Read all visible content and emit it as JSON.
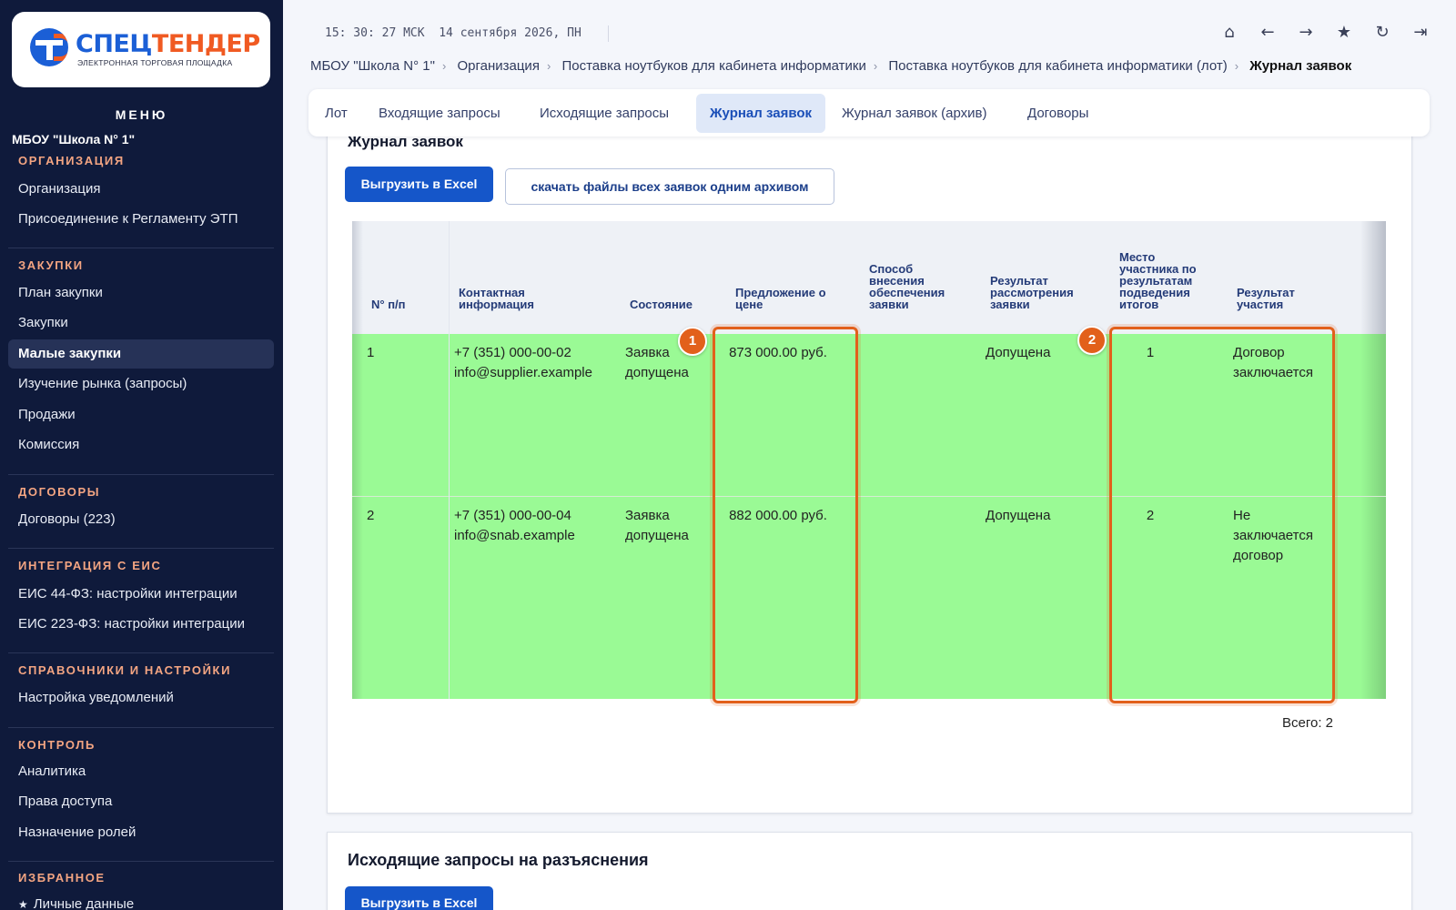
{
  "app": {
    "logo_main_a": "СПЕЦ",
    "logo_main_b": "ТЕНДЕР",
    "logo_sub": "ЭЛЕКТРОННАЯ ТОРГОВАЯ ПЛОЩАДКА",
    "colors": {
      "sidebar_bg": "#0f1a3b",
      "accent_blue": "#1556c9",
      "accent_orange": "#e2601b",
      "row_green": "#9afa95"
    }
  },
  "sidebar": {
    "menu_title": "МЕНЮ",
    "org_name": "МБОУ \"Школа N° 1\"",
    "sections": [
      {
        "title": "ОРГАНИЗАЦИЯ",
        "items": [
          "Организация",
          "Присоединение к Регламенту ЭТП"
        ]
      },
      {
        "title": "ЗАКУПКИ",
        "items": [
          "План закупки",
          "Закупки",
          "Малые закупки",
          "Изучение рынка (запросы)",
          "Продажи",
          "Комиссия"
        ]
      },
      {
        "title": "ДОГОВОРЫ",
        "items": [
          "Договоры (223)"
        ]
      },
      {
        "title": "ИНТЕГРАЦИЯ С ЕИС",
        "items": [
          "ЕИС 44-ФЗ: настройки интеграции",
          "ЕИС 223-ФЗ: настройки интеграции"
        ]
      },
      {
        "title": "СПРАВОЧНИКИ И НАСТРОЙКИ",
        "items": [
          "Настройка уведомлений"
        ]
      },
      {
        "title": "КОНТРОЛЬ",
        "items": [
          "Аналитика",
          "Права доступа",
          "Назначение ролей"
        ]
      },
      {
        "title": "ИЗБРАННОЕ",
        "items": [
          "Личные данные"
        ]
      }
    ],
    "active_item": "Малые закупки"
  },
  "topbar": {
    "time": "15: 30: 27 МСК",
    "date": "14 сентября 2026, ПН",
    "icons": [
      "home-icon",
      "arrow-left-icon",
      "arrow-right-icon",
      "star-icon",
      "refresh-icon",
      "logout-icon"
    ]
  },
  "breadcrumb": [
    "МБОУ \"Школа N° 1\"",
    "Организация",
    "Поставка ноутбуков для кабинета информатики",
    "Поставка ноутбуков для кабинета информатики (лот)",
    "Журнал заявок"
  ],
  "tabs": [
    "Лот",
    "Входящие запросы",
    "Исходящие запросы",
    "Журнал заявок",
    "Журнал заявок (архив)",
    "Договоры"
  ],
  "active_tab": "Журнал заявок",
  "journal": {
    "title": "Журнал заявок",
    "export_label": "Выгрузить в Excel",
    "download_all_label": "скачать файлы всех заявок одним архивом",
    "columns": [
      "N° п/п",
      "Контактная информация",
      "Состояние",
      "Предложение о цене",
      "Способ внесения обеспечения заявки",
      "Результат рассмотрения заявки",
      "Место участника по результатам подведения итогов",
      "Результат участия"
    ],
    "rows": [
      {
        "num": "1",
        "phone": "+7 (351) 000-00-02",
        "email": "info@supplier.example",
        "state": "Заявка допущена",
        "price": "873 000.00 руб.",
        "security": "",
        "review": "Допущена",
        "place": "1",
        "result": "Договор заключается"
      },
      {
        "num": "2",
        "phone": "+7 (351) 000-00-04",
        "email": "info@snab.example",
        "state": "Заявка допущена",
        "price": "882 000.00 руб.",
        "security": "",
        "review": "Допущена",
        "place": "2",
        "result": "Не заключается договор"
      }
    ],
    "total": "Всего: 2",
    "badges": [
      "1",
      "2"
    ]
  },
  "outgoing": {
    "title": "Исходящие запросы на разъяснения",
    "export_label": "Выгрузить в Excel"
  }
}
